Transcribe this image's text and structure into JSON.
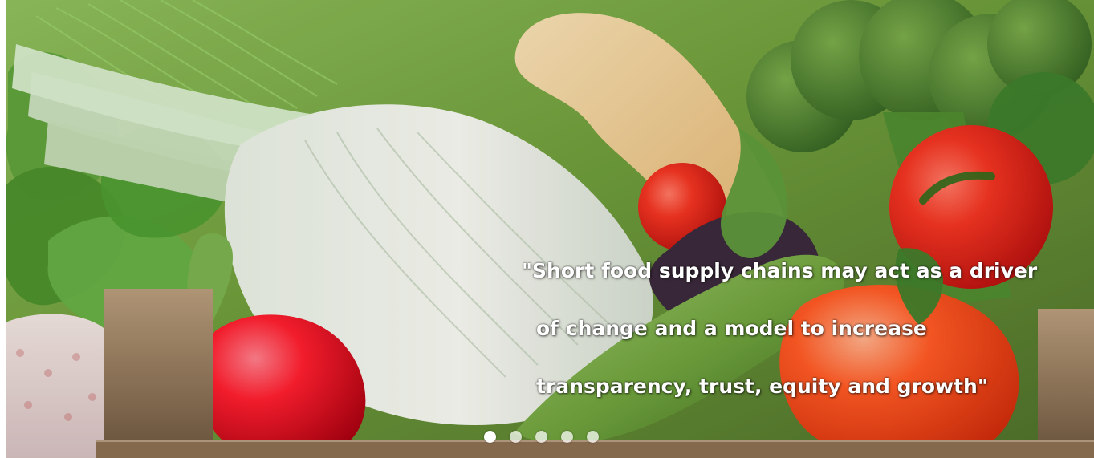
{
  "slider": {
    "caption_lines": [
      "\"Short food supply chains may act as a driver",
      "of change and a model to increase",
      "transparency, trust, equity and growth\""
    ],
    "slides_count": 5,
    "active_slide_index": 0
  },
  "colors": {
    "caption_text": "#ffffff",
    "dot_active": "#ffffff",
    "dot_inactive": "rgba(255,255,255,0.72)"
  },
  "image_semantics": {
    "subject": "fresh vegetables in wooden crate",
    "items": [
      "fennel",
      "lettuce",
      "butternut squash",
      "broccoli",
      "tomatoes",
      "eggplant",
      "zucchini",
      "red bell pepper",
      "orange bell pepper"
    ]
  }
}
